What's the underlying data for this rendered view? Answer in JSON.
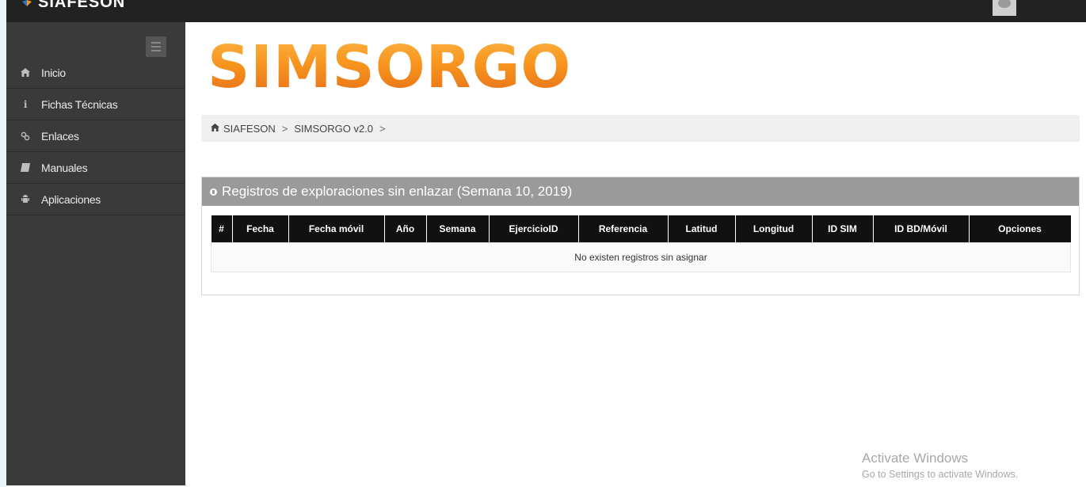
{
  "app": {
    "brand": "SIAFESON",
    "logo_text": "SIMSORGO"
  },
  "sidebar": {
    "items": [
      {
        "label": "Inicio",
        "icon": "home-icon"
      },
      {
        "label": "Fichas Técnicas",
        "icon": "info-icon"
      },
      {
        "label": "Enlaces",
        "icon": "link-icon"
      },
      {
        "label": "Manuales",
        "icon": "book-icon"
      },
      {
        "label": "Aplicaciones",
        "icon": "android-icon"
      }
    ]
  },
  "breadcrumb": {
    "items": [
      "SIAFESON",
      "SIMSORGO v2.0"
    ],
    "separator": ">"
  },
  "panel": {
    "title": "Registros de exploraciones sin enlazar (Semana 10, 2019)",
    "table": {
      "headers": [
        "#",
        "Fecha",
        "Fecha móvil",
        "Año",
        "Semana",
        "EjercicioID",
        "Referencia",
        "Latitud",
        "Longitud",
        "ID SIM",
        "ID BD/Móvil",
        "Opciones"
      ],
      "empty_message": "No existen registros sin asignar"
    }
  },
  "watermark": {
    "line1": "Activate Windows",
    "line2": "Go to Settings to activate Windows."
  },
  "colors": {
    "topbar": "#222222",
    "sidebar": "#3a3a3a",
    "logo_orange": "#f7941d",
    "panel_header": "#9a9a9a",
    "table_header": "#111111"
  }
}
